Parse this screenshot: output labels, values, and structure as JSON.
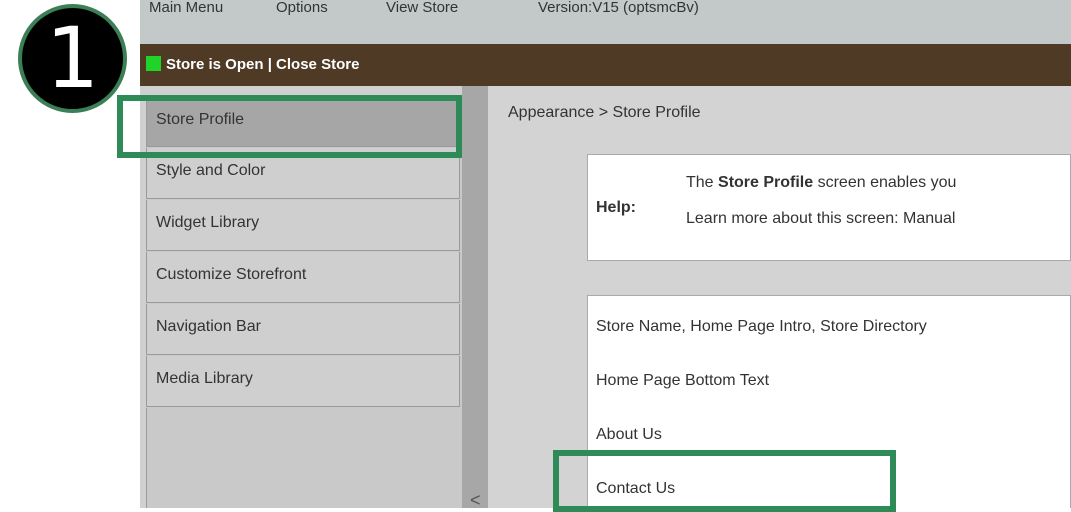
{
  "menu": {
    "items": [
      "Main Menu",
      "Options",
      "View Store",
      "Version:V15 (optsmcBv)"
    ]
  },
  "status": {
    "text": "Store is Open |  Close Store",
    "indicator_color": "#1fd329"
  },
  "sidebar": {
    "items": [
      {
        "label": "Store Profile"
      },
      {
        "label": "Style and Color"
      },
      {
        "label": "Widget Library"
      },
      {
        "label": "Customize Storefront"
      },
      {
        "label": "Navigation Bar"
      },
      {
        "label": "Media Library"
      }
    ],
    "collapse_glyph": "<"
  },
  "main": {
    "breadcrumb": "Appearance > Store Profile",
    "help": {
      "label": "Help:",
      "line1_pre": "The ",
      "line1_bold": "Store Profile",
      "line1_post": " screen enables you",
      "line2": "Learn more about this screen: Manual"
    },
    "links": [
      "Store Name, Home Page Intro, Store Directory",
      "Home Page Bottom Text",
      "About Us",
      "Contact Us"
    ]
  },
  "annotation": {
    "step_number": "1",
    "highlight_color": "#2e8b57"
  }
}
